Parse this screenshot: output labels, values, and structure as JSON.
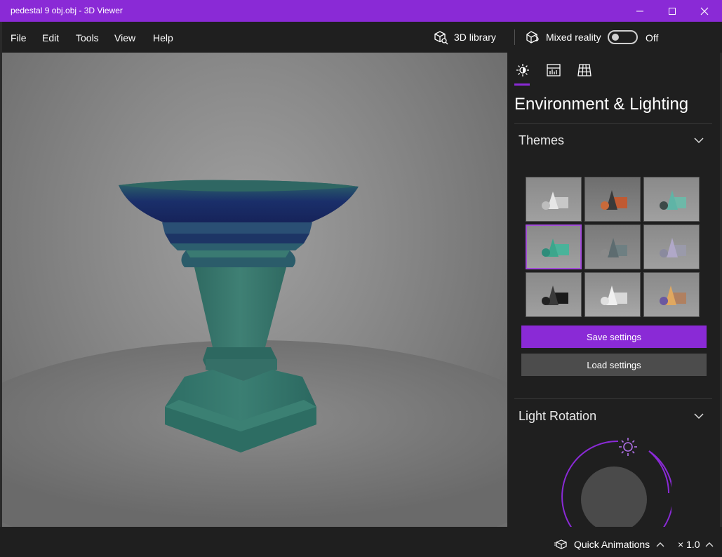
{
  "window": {
    "title": "pedestal 9 obj.obj - 3D Viewer",
    "accent_color": "#8a2ad6"
  },
  "menu": {
    "items": [
      "File",
      "Edit",
      "Tools",
      "View",
      "Help"
    ]
  },
  "toolbar": {
    "library_label": "3D library",
    "mixed_reality_label": "Mixed reality",
    "mixed_reality_state": "Off"
  },
  "panel": {
    "tabs": [
      "environment-lighting-tab",
      "stats-tab",
      "grid-tab"
    ],
    "title": "Environment & Lighting",
    "themes": {
      "title": "Themes",
      "selected_index": 3,
      "items": [
        "theme-1",
        "theme-2",
        "theme-3",
        "theme-4",
        "theme-5",
        "theme-6",
        "theme-7",
        "theme-8",
        "theme-9"
      ]
    },
    "save_label": "Save settings",
    "load_label": "Load settings",
    "light_rotation": {
      "title": "Light Rotation"
    }
  },
  "statusbar": {
    "quick_animations_label": "Quick Animations",
    "speed_label": "× 1.0"
  },
  "model": {
    "color": "#3e7a6e",
    "rim_color": "#1e2f66"
  }
}
